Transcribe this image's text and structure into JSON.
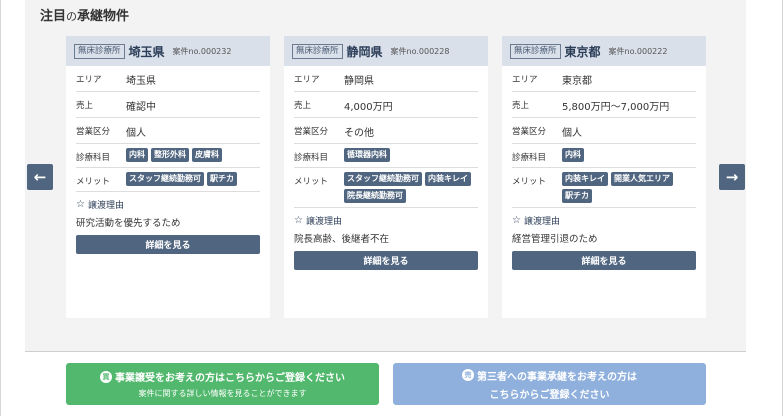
{
  "section": {
    "title_main": "注目",
    "title_small": "の",
    "title_rest": "承継物件"
  },
  "cards": [
    {
      "badge": "無床診療所",
      "pref": "埼玉県",
      "case_no": "案件no.000232",
      "area_label": "エリア",
      "area": "埼玉県",
      "sales_label": "売上",
      "sales": "確認中",
      "type_label": "営業区分",
      "type": "個人",
      "dept_label": "診療科目",
      "depts": [
        "内科",
        "整形外科",
        "皮膚科"
      ],
      "merit_label": "メリット",
      "merits": [
        "スタッフ継続勤務可",
        "駅チカ"
      ],
      "reason_label": "譲渡理由",
      "reason": "研究活動を優先するため",
      "detail_label": "詳細を見る"
    },
    {
      "badge": "無床診療所",
      "pref": "静岡県",
      "case_no": "案件no.000228",
      "area_label": "エリア",
      "area": "静岡県",
      "sales_label": "売上",
      "sales": "4,000万円",
      "type_label": "営業区分",
      "type": "その他",
      "dept_label": "診療科目",
      "depts": [
        "循環器内科"
      ],
      "merit_label": "メリット",
      "merits": [
        "スタッフ継続勤務可",
        "内装キレイ",
        "院長継続勤務可"
      ],
      "reason_label": "譲渡理由",
      "reason": "院長高齢、後継者不在",
      "detail_label": "詳細を見る"
    },
    {
      "badge": "無床診療所",
      "pref": "東京都",
      "case_no": "案件no.000222",
      "area_label": "エリア",
      "area": "東京都",
      "sales_label": "売上",
      "sales": "5,800万円〜7,000万円",
      "type_label": "営業区分",
      "type": "個人",
      "dept_label": "診療科目",
      "depts": [
        "内科"
      ],
      "merit_label": "メリット",
      "merits": [
        "内装キレイ",
        "開業人気エリア",
        "駅チカ"
      ],
      "reason_label": "譲渡理由",
      "reason": "経営管理引退のため",
      "detail_label": "詳細を見る"
    }
  ],
  "nav": {
    "prev": "←",
    "next": "→"
  },
  "cta_buy": {
    "icon": "買",
    "line1": "事業譲受をお考えの方はこちらからご登録ください",
    "line2": "案件に関する詳しい情報を見ることができます",
    "color": "#52b86e"
  },
  "cta_sell": {
    "icon": "売",
    "line1": "第三者への事業承継をお考えの方は",
    "line2": "こちらからご登録ください",
    "color": "#8fb0dd"
  }
}
